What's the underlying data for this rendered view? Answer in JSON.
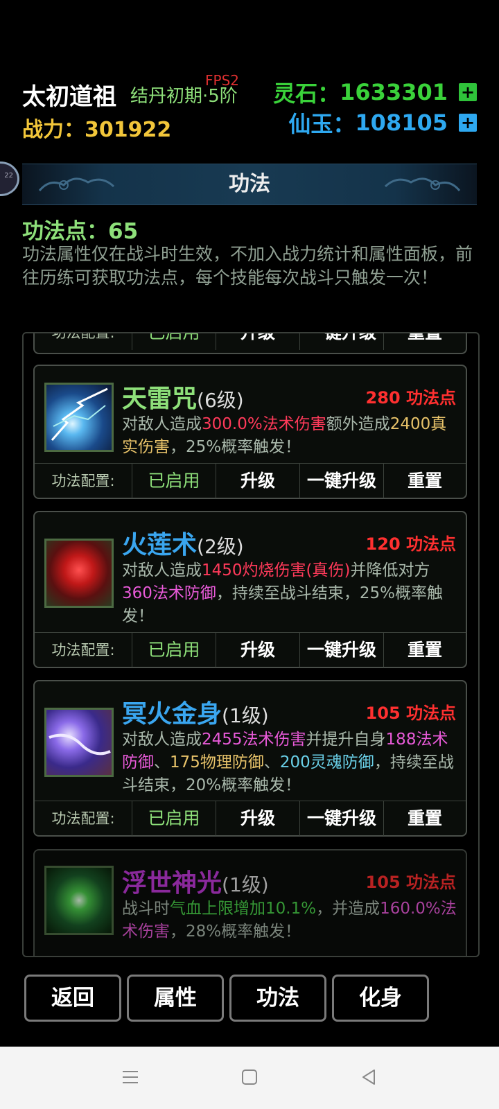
{
  "header": {
    "player_name": "太初道祖",
    "realm": "结丹初期·5阶",
    "fps": "FPS2",
    "combat_power_label": "战力：",
    "combat_power": "301922",
    "lingshi_label": "灵石：",
    "lingshi": "1633301",
    "xianyu_label": "仙玉：",
    "xianyu": "108105",
    "plus": "+"
  },
  "avatar_badge": "22",
  "section": {
    "title": "功法"
  },
  "points": {
    "label": "功法点：",
    "value": "65"
  },
  "description": "功法属性仅在战斗时生效，不加入战力统计和属性面板，前往历练可获取功法点，每个技能每次战斗只触发一次！",
  "config_row": {
    "label": "功法配置:",
    "enabled": "已启用",
    "upgrade": "升级",
    "one_click_upgrade": "一键升级",
    "reset": "重置"
  },
  "skills": [
    {
      "name": "天雷咒",
      "level": "(6级)",
      "cost": "280 功法点",
      "name_color": "#8ee07a",
      "desc": [
        "对敌人造成",
        "300.0%法术伤害",
        "额外造成",
        "2400真实伤害",
        "，25%概率触发！"
      ]
    },
    {
      "name": "火莲术",
      "level": "(2级)",
      "cost": "120 功法点",
      "name_color": "#3aa6f0",
      "desc": [
        "对敌人造成",
        "1450灼烧伤害(真伤)",
        "并降低对方",
        "360法术防御",
        "，持续至战斗结束，25%概率触发！"
      ]
    },
    {
      "name": "冥火金身",
      "level": "(1级)",
      "cost": "105 功法点",
      "name_color": "#3aa6f0",
      "desc": [
        "对敌人造成",
        "2455法术伤害",
        "并提升自身",
        "188法术防御",
        "、",
        "175物理防御",
        "、",
        "200灵魂防御",
        "，持续至战斗结束，20%概率触发！"
      ]
    },
    {
      "name": "浮世神光",
      "level": "(1级)",
      "cost": "105 功法点",
      "name_color": "#c03ad8",
      "desc": [
        "战斗时",
        "气血上限增加10.1%",
        "，并造成",
        "160.0%法术伤害",
        "，28%概率触发！"
      ]
    }
  ],
  "bottom_nav": [
    "返回",
    "属性",
    "功法",
    "化身"
  ]
}
